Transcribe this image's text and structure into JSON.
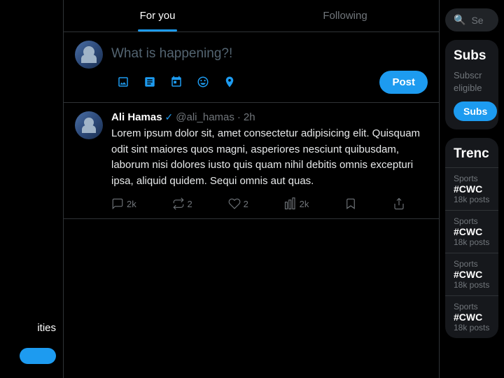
{
  "left_sidebar": {
    "label": "ities",
    "blue_button": ""
  },
  "tabs": [
    {
      "id": "for-you",
      "label": "For you",
      "active": true
    },
    {
      "id": "following",
      "label": "Following",
      "active": false
    }
  ],
  "compose": {
    "placeholder": "What is happening?!",
    "post_button": "Post"
  },
  "tweet": {
    "name": "Ali Hamas",
    "verified": true,
    "handle": "@ali_hamas",
    "time": "2h",
    "text": "Lorem ipsum dolor sit, amet consectetur adipisicing elit. Quisquam odit sint maiores quos magni, asperiores nesciunt quibusdam, laborum nisi dolores iusto quis quam nihil debitis omnis excepturi ipsa, aliquid quidem. Sequi omnis aut quas.",
    "actions": {
      "replies": "2k",
      "retweets": "2",
      "likes": "2",
      "views": "2k"
    }
  },
  "right_sidebar": {
    "search_placeholder": "Se",
    "subscribe_card": {
      "title": "Subs",
      "description": "Subscr eligible",
      "button": "Subs"
    },
    "trending_card": {
      "title": "Trenc",
      "trends": [
        {
          "category": "Sports",
          "hashtag": "#CWC",
          "posts": "18k posts"
        },
        {
          "category": "Sports",
          "hashtag": "#CWC",
          "posts": "18k posts"
        },
        {
          "category": "Sports",
          "hashtag": "#CWC",
          "posts": "18k posts"
        },
        {
          "category": "Sports",
          "hashtag": "#CWC",
          "posts": "18k posts"
        }
      ]
    }
  }
}
